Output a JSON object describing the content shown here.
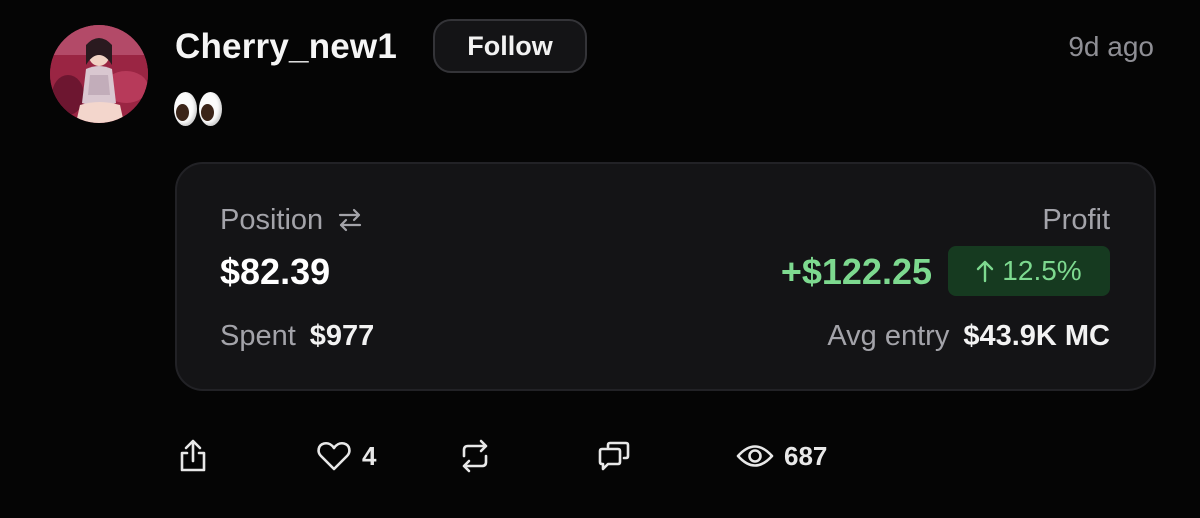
{
  "post": {
    "username": "Cherry_new1",
    "follow_label": "Follow",
    "timestamp": "9d ago",
    "content": "👀"
  },
  "card": {
    "position_label": "Position",
    "position_value": "$82.39",
    "profit_label": "Profit",
    "profit_value": "+$122.25",
    "profit_percent": "12.5%",
    "spent_label": "Spent",
    "spent_value": "$977",
    "avg_entry_label": "Avg entry",
    "avg_entry_value": "$43.9K MC"
  },
  "actions": {
    "likes": "4",
    "views": "687"
  },
  "icons": {
    "swap": "swap-arrows-icon",
    "up_arrow": "arrow-up-icon",
    "share": "share-icon",
    "like": "heart-icon",
    "repost": "repost-icon",
    "comment": "comment-icon",
    "views": "eye-icon"
  },
  "colors": {
    "background": "#050505",
    "card": "#141416",
    "profit_green": "#7dd98f",
    "badge_bg": "#163a20",
    "muted": "#a3a3a9"
  }
}
